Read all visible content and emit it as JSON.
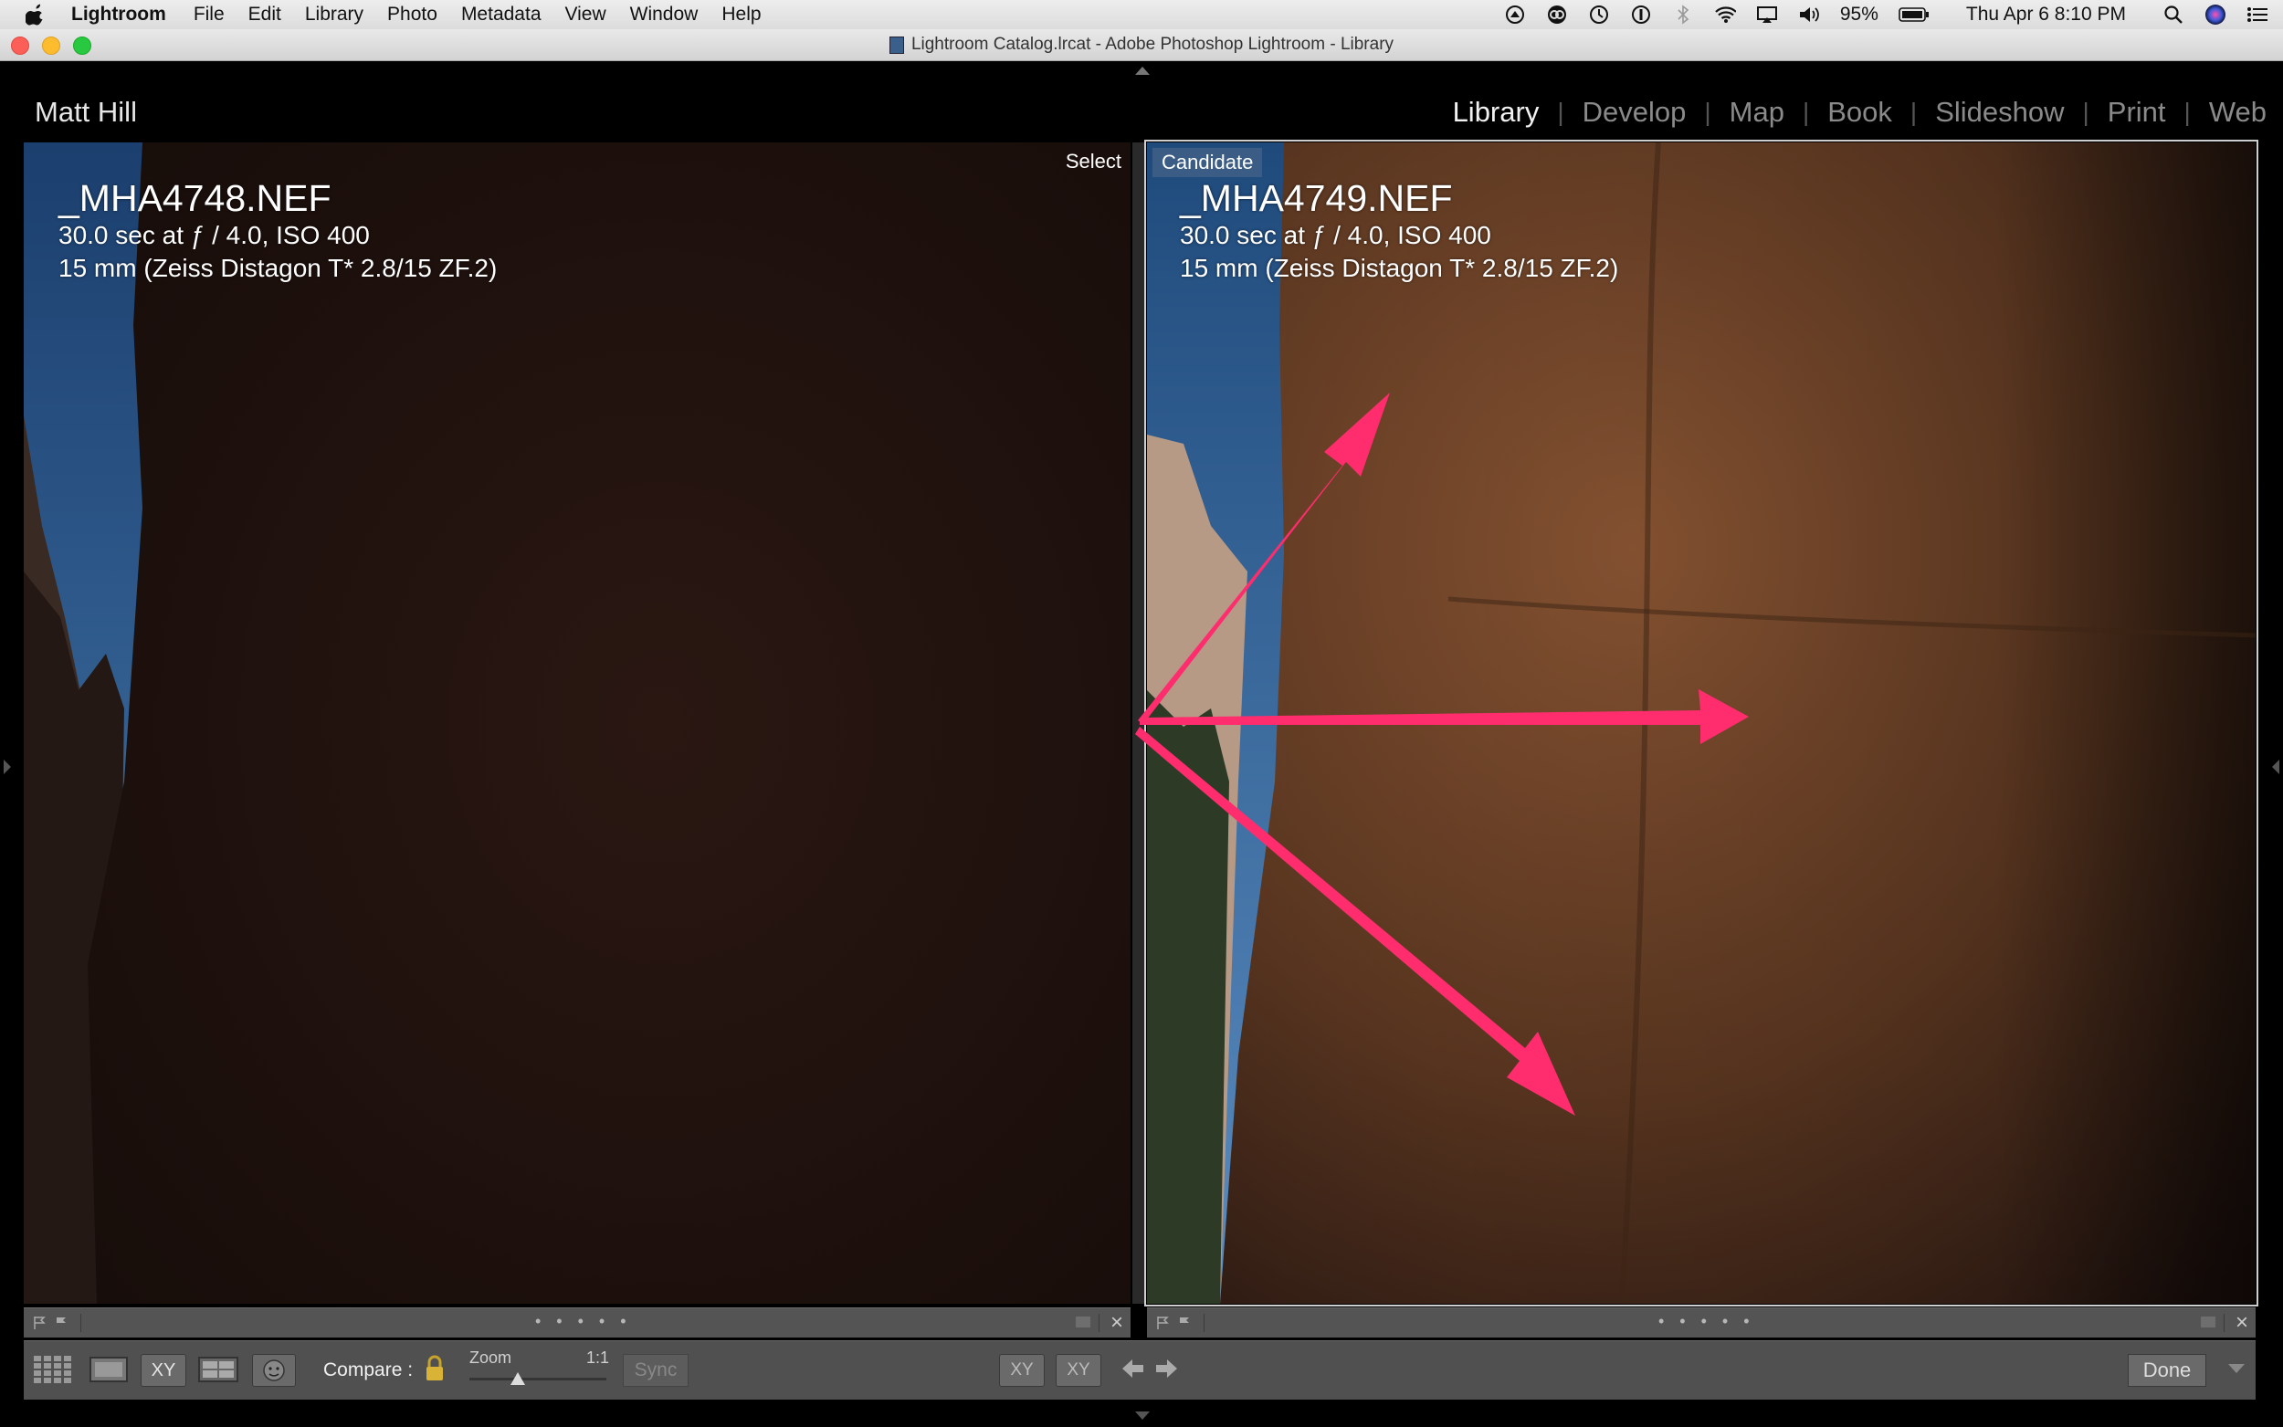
{
  "menubar": {
    "app_name": "Lightroom",
    "items": [
      "File",
      "Edit",
      "Library",
      "Photo",
      "Metadata",
      "View",
      "Window",
      "Help"
    ],
    "battery": "95%",
    "clock": "Thu Apr 6  8:10 PM"
  },
  "window": {
    "title": "Lightroom Catalog.lrcat - Adobe Photoshop Lightroom - Library"
  },
  "identity_plate": "Matt Hill",
  "modules": [
    {
      "label": "Library",
      "active": true
    },
    {
      "label": "Develop",
      "active": false
    },
    {
      "label": "Map",
      "active": false
    },
    {
      "label": "Book",
      "active": false
    },
    {
      "label": "Slideshow",
      "active": false
    },
    {
      "label": "Print",
      "active": false
    },
    {
      "label": "Web",
      "active": false
    }
  ],
  "select_pane": {
    "badge": "Select",
    "filename": "_MHA4748.NEF",
    "exposure": "30.0 sec at ƒ / 4.0, ISO 400",
    "lens": "15 mm (Zeiss Distagon T* 2.8/15 ZF.2)"
  },
  "candidate_pane": {
    "badge": "Candidate",
    "filename": "_MHA4749.NEF",
    "exposure": "30.0 sec at ƒ / 4.0, ISO 400",
    "lens": "15 mm (Zeiss Distagon T* 2.8/15 ZF.2)"
  },
  "toolbar": {
    "compare_label": "Compare :",
    "zoom_label": "Zoom",
    "zoom_max": "1:1",
    "zoom_level": 0.35,
    "sync_label": "Sync",
    "done_label": "Done",
    "xy_label": "XY",
    "swap_label": "XY",
    "make_select_label": "XY"
  },
  "colors": {
    "accent_arrow": "#ff2d6e",
    "candidate_badge": "#3b5d85",
    "toolbar_bg": "#505050"
  }
}
